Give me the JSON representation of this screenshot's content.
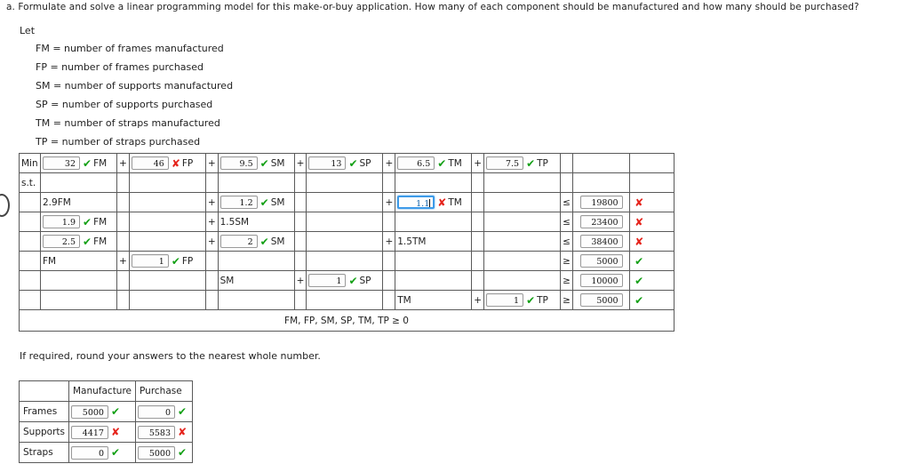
{
  "question": {
    "label": "a.",
    "text": "a. Formulate and solve a linear programming model for this make-or-buy application. How many of each component should be manufactured and how many should be purchased?"
  },
  "definitions": {
    "let_label": "Let",
    "items": [
      "FM  =  number of frames manufactured",
      "FP  =  number of frames purchased",
      "SM  =  number of supports manufactured",
      "SP  =  number of supports purchased",
      "TM  =  number of straps manufactured",
      "TP  =  number of straps purchased"
    ]
  },
  "colors": {
    "correct": "#14a016",
    "incorrect": "#e5231b",
    "focus": "#3d9ae8"
  },
  "marks": {
    "ok": "✔",
    "bad": "✘"
  },
  "model": {
    "min_label": "Min",
    "st_label": "s.t.",
    "objective": {
      "terms": [
        {
          "value": "32",
          "mark": "ok",
          "var": "FM",
          "op": ""
        },
        {
          "value": "46",
          "mark": "bad",
          "var": "FP",
          "op": "+"
        },
        {
          "value": "9.5",
          "mark": "ok",
          "var": "SM",
          "op": "+"
        },
        {
          "value": "13",
          "mark": "ok",
          "var": "SP",
          "op": "+"
        },
        {
          "value": "6.5",
          "mark": "ok",
          "var": "TM",
          "op": "+"
        },
        {
          "value": "7.5",
          "mark": "ok",
          "var": "TP",
          "op": "+"
        }
      ]
    },
    "constraints": [
      {
        "c1_static": "2.9FM",
        "c1_value": "",
        "c1_mark": "",
        "c1_var": "",
        "op2": "+",
        "c2_static": "",
        "c2_value": "1.2",
        "c2_mark": "ok",
        "c2_var": "SM",
        "op3": "+",
        "c3_static": "",
        "c3_value": "1.1",
        "c3_mark": "bad",
        "c3_var": "TM",
        "c3_focused": true,
        "relation": "≤",
        "rhs": "19800",
        "rhs_mark": "bad"
      },
      {
        "c1_static": "",
        "c1_value": "1.9",
        "c1_mark": "ok",
        "c1_var": "FM",
        "op2": "+",
        "c2_static": "1.5SM",
        "c2_value": "",
        "c2_mark": "",
        "c2_var": "",
        "op3": "",
        "c3_static": "",
        "c3_value": "",
        "c3_mark": "",
        "c3_var": "",
        "c3_focused": false,
        "relation": "≤",
        "rhs": "23400",
        "rhs_mark": "bad"
      },
      {
        "c1_static": "",
        "c1_value": "2.5",
        "c1_mark": "ok",
        "c1_var": "FM",
        "op2": "+",
        "c2_static": "",
        "c2_value": "2",
        "c2_mark": "ok",
        "c2_var": "SM",
        "op3": "+",
        "c3_static": "1.5TM",
        "c3_value": "",
        "c3_mark": "",
        "c3_var": "",
        "c3_focused": false,
        "relation": "≤",
        "rhs": "38400",
        "rhs_mark": "bad"
      }
    ],
    "demand": [
      {
        "static": "FM",
        "op": "+",
        "value": "1",
        "mark": "ok",
        "var": "FP",
        "group": 1,
        "relation": "≥",
        "rhs": "5000",
        "rhs_mark": "ok"
      },
      {
        "static": "SM",
        "op": "+",
        "value": "1",
        "mark": "ok",
        "var": "SP",
        "group": 2,
        "relation": "≥",
        "rhs": "10000",
        "rhs_mark": "ok"
      },
      {
        "static": "TM",
        "op": "+",
        "value": "1",
        "mark": "ok",
        "var": "TP",
        "group": 3,
        "relation": "≥",
        "rhs": "5000",
        "rhs_mark": "ok"
      }
    ],
    "nonneg": "FM, FP, SM, SP, TM, TP ≥ 0"
  },
  "round_note": "If required, round your answers to the nearest whole number.",
  "answer_table": {
    "corner": "",
    "headers": [
      "Manufacture",
      "Purchase"
    ],
    "rows": [
      {
        "label": "Frames",
        "manufacture": "5000",
        "manufacture_mark": "ok",
        "purchase": "0",
        "purchase_mark": "ok"
      },
      {
        "label": "Supports",
        "manufacture": "4417",
        "manufacture_mark": "bad",
        "purchase": "5583",
        "purchase_mark": "bad"
      },
      {
        "label": "Straps",
        "manufacture": "0",
        "manufacture_mark": "ok",
        "purchase": "5000",
        "purchase_mark": "ok"
      }
    ]
  }
}
